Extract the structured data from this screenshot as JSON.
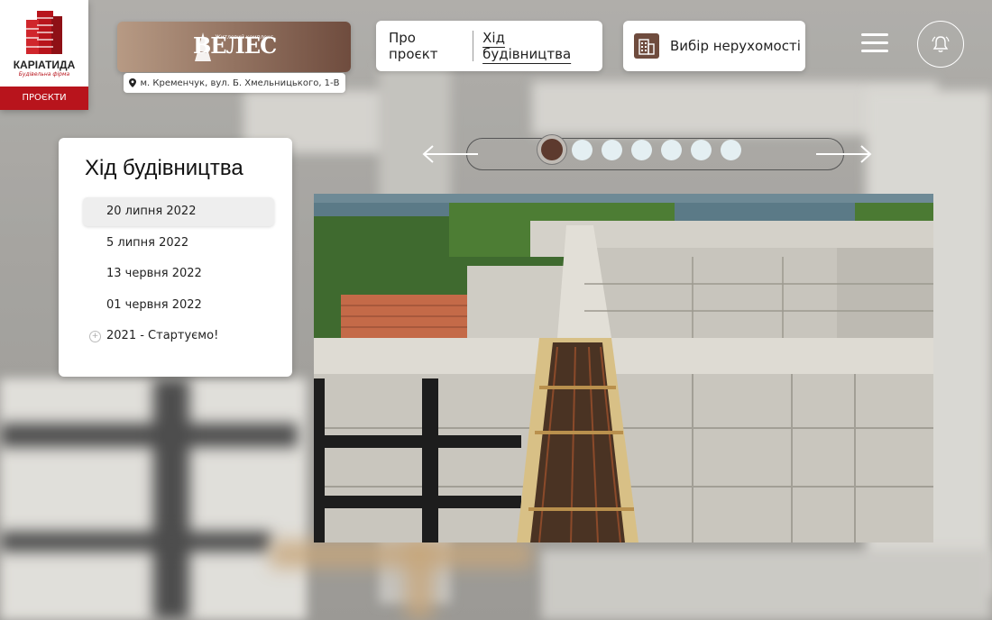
{
  "logo": {
    "brand": "КАРІАТИДА",
    "subtitle": "Будівельна фірма",
    "projects_label": "ПРОЄКТИ"
  },
  "project": {
    "name": "ВЕЛЕС",
    "tagline": "Житловий комплекс",
    "address": "м. Кременчук, вул. Б. Хмельницького, 1-В"
  },
  "nav": {
    "about_label": "Про проєкт",
    "progress_label": "Хід будівництва",
    "select_label": "Вибір нерухомості"
  },
  "icons": {
    "menu": "hamburger-menu-icon",
    "bell": "bell-icon",
    "building": "building-icon",
    "location": "location-pin-icon"
  },
  "timeline": {
    "title": "Хід будівництва",
    "items": [
      {
        "label": "20 липня 2022",
        "active": true
      },
      {
        "label": "5 липня 2022",
        "active": false
      },
      {
        "label": "13 червня 2022",
        "active": false
      },
      {
        "label": "01 червня 2022",
        "active": false
      },
      {
        "label": "2021 - Стартуємо!",
        "active": false
      }
    ]
  },
  "slider": {
    "total": 7,
    "current": 1
  },
  "colors": {
    "brand_red": "#b8141c",
    "accent_brown": "#5d3a2e",
    "dot_inactive": "#e4eff2"
  }
}
